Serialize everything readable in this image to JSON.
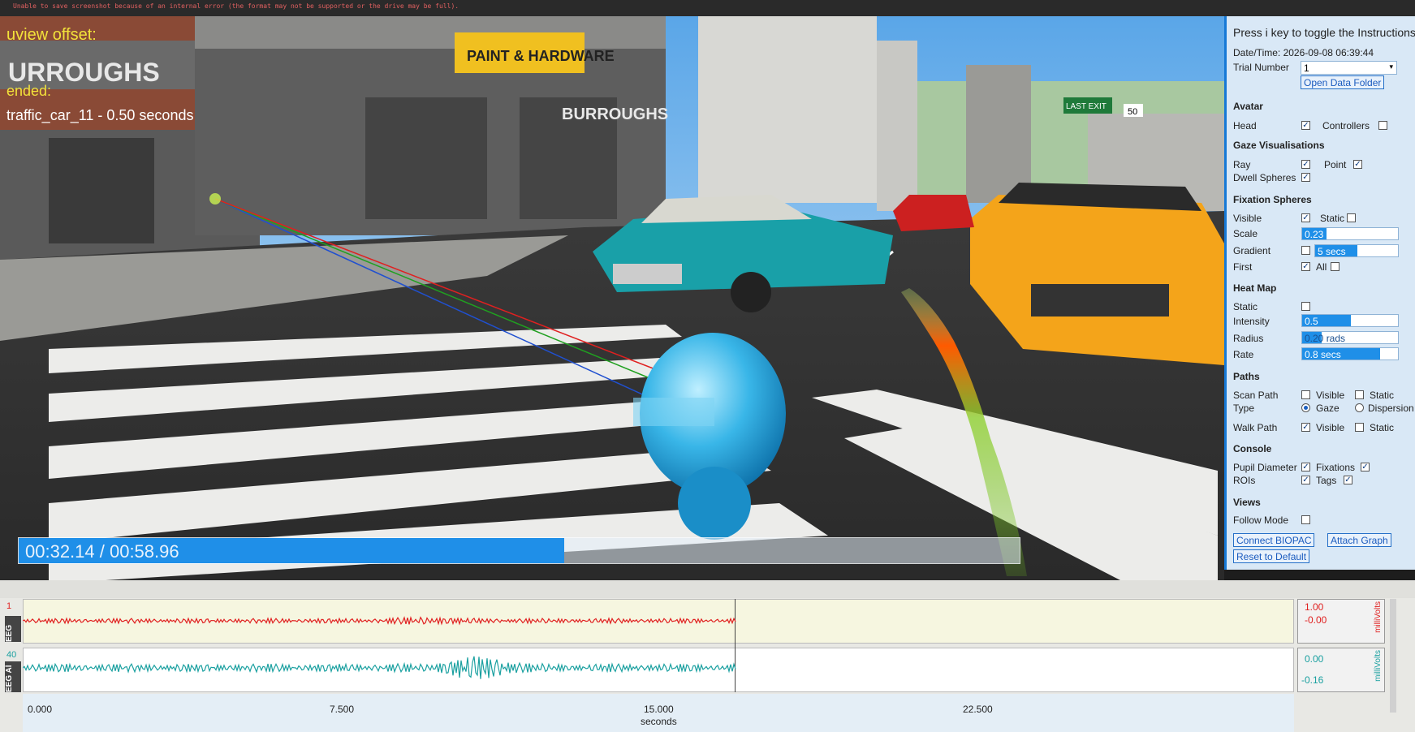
{
  "error_bar": {
    "message": "Unable to save screenshot because of an internal error (the format may not be supported or the drive may be full)."
  },
  "overlay": {
    "line1": "uview offset:",
    "line2": "ended:",
    "line3": "traffic_car_11 - 0.50 seconds"
  },
  "scene_signs": {
    "burroughs_top": "URROUGHS",
    "burroughs_side": "BURROUGHS",
    "paint_sign": "PAINT & HARDWARE",
    "last_exit": "LAST EXIT",
    "speed": "50"
  },
  "playback": {
    "time_text": "00:32.14 / 00:58.96",
    "progress_fraction": 0.545
  },
  "panel": {
    "instructions": "Press i key to toggle the Instructions",
    "datetime": "Date/Time: 2026-09-08 06:39:44",
    "trial_label": "Trial Number",
    "trial_value": "1",
    "open_folder": "Open Data Folder",
    "avatar": {
      "title": "Avatar",
      "head": "Head",
      "controllers": "Controllers"
    },
    "gaze": {
      "title": "Gaze Visualisations",
      "ray": "Ray",
      "point": "Point",
      "dwell": "Dwell Spheres"
    },
    "fixation": {
      "title": "Fixation Spheres",
      "visible": "Visible",
      "static": "Static",
      "scale": "Scale",
      "scale_value": "0.23",
      "gradient": "Gradient",
      "gradient_value": "5 secs",
      "first": "First",
      "all": "All"
    },
    "heatmap": {
      "title": "Heat Map",
      "static": "Static",
      "intensity": "Intensity",
      "intensity_value": "0.5",
      "radius": "Radius",
      "radius_value": "0.20 rads",
      "rate": "Rate",
      "rate_value": "0.8 secs"
    },
    "paths": {
      "title": "Paths",
      "scan_path": "Scan Path",
      "visible": "Visible",
      "static": "Static",
      "type": "Type",
      "gaze": "Gaze",
      "dispersion": "Dispersion",
      "walk_path": "Walk Path"
    },
    "console": {
      "title": "Console",
      "pupil": "Pupil Diameter",
      "fixations": "Fixations",
      "rois": "ROIs",
      "tags": "Tags"
    },
    "views": {
      "title": "Views",
      "follow": "Follow Mode"
    },
    "buttons": {
      "biopac": "Connect BIOPAC",
      "graph": "Attach Graph",
      "reset": "Reset to Default"
    }
  },
  "graph": {
    "ch1": {
      "num": "1",
      "label": "EEG",
      "max": "1.00",
      "min": "-0.00",
      "unit": "milliVolts",
      "color": "#e02020"
    },
    "ch2": {
      "num": "40",
      "label": "EEG Al",
      "max": "0.00",
      "min": "-0.16",
      "unit": "milliVolts",
      "color": "#1aa0a0"
    },
    "xticks": [
      "0.000",
      "7.500",
      "15.000",
      "22.500"
    ],
    "xlabel": "seconds"
  }
}
